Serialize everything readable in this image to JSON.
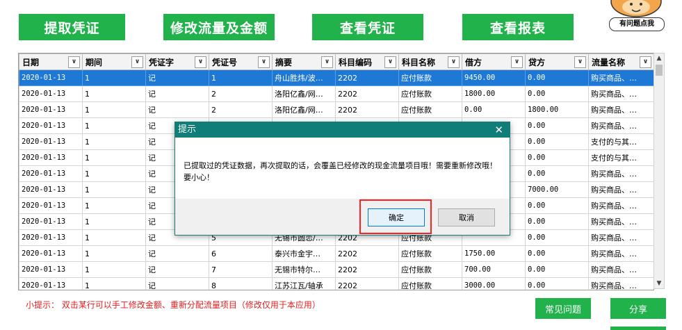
{
  "toolbar": {
    "extract_label": "提取凭证",
    "modify_label": "修改流量及金额",
    "view_voucher_label": "查看凭证",
    "view_report_label": "查看报表"
  },
  "help_mascot": {
    "label": "有问题点我",
    "icon": "monkey-mascot-icon"
  },
  "table": {
    "columns": [
      "日期",
      "期间",
      "凭证字",
      "凭证号",
      "摘要",
      "科目编码",
      "科目名称",
      "借方",
      "贷方",
      "流量名称"
    ],
    "rows": [
      [
        "2020-01-13",
        "1",
        "记",
        "1",
        "舟山胜炜/波…",
        "2202",
        "应付账款",
        "9450.00",
        "0.00",
        "购买商品、…"
      ],
      [
        "2020-01-13",
        "1",
        "记",
        "2",
        "洛阳亿鑫/网…",
        "2202",
        "应付账款",
        "1800.00",
        "0.00",
        "购买商品、…"
      ],
      [
        "2020-01-13",
        "1",
        "记",
        "2",
        "洛阳亿鑫/网…",
        "2202",
        "应付账款",
        "0.00",
        "1800.00",
        "购买商品、…"
      ],
      [
        "2020-01-13",
        "1",
        "记",
        "",
        "",
        "",
        "",
        "",
        "0.00",
        "购买商品、…"
      ],
      [
        "2020-01-13",
        "1",
        "记",
        "",
        "",
        "",
        "",
        "",
        "0.00",
        "支付的与其…"
      ],
      [
        "2020-01-13",
        "1",
        "记",
        "",
        "",
        "",
        "",
        "",
        "0.00",
        "支付的与其…"
      ],
      [
        "2020-01-13",
        "1",
        "记",
        "",
        "",
        "",
        "",
        "",
        "0.00",
        "购买商品、…"
      ],
      [
        "2020-01-13",
        "1",
        "记",
        "",
        "",
        "",
        "",
        "",
        "7000.00",
        "购买商品、…"
      ],
      [
        "2020-01-13",
        "1",
        "记",
        "",
        "",
        "",
        "",
        "",
        "0.00",
        "购买商品、…"
      ],
      [
        "2020-01-13",
        "1",
        "记",
        "",
        "",
        "",
        "",
        "",
        "0.00",
        "购买商品、…"
      ],
      [
        "2020-01-13",
        "1",
        "记",
        "5",
        "无锡市圆恋/…",
        "2202",
        "应付账款",
        "",
        "0.00",
        "购买商品、…"
      ],
      [
        "2020-01-13",
        "1",
        "记",
        "6",
        "泰兴市金宇…",
        "2202",
        "应付账款",
        "1750.00",
        "0.00",
        "购买商品、…"
      ],
      [
        "2020-01-13",
        "1",
        "记",
        "7",
        "无锡市特尔…",
        "2202",
        "应付账款",
        "700.00",
        "0.00",
        "购买商品、…"
      ],
      [
        "2020-01-13",
        "1",
        "记",
        "8",
        "江苏江瓦/轴承",
        "2202",
        "应付账款",
        "3000.00",
        "0.00",
        "购买商品、…"
      ]
    ],
    "selected_row": 0
  },
  "tip": "小提示：   双击某行可以手工修改金额、重新分配流量项目（修改仅用于本应用）",
  "bottom": {
    "faq_label": "常见问题",
    "share_label": "分享"
  },
  "dialog": {
    "title": "提示",
    "message": "已提取过的凭证数据，再次提取的话，会覆盖已经修改的现金流量项目哦！需要重新修改哦！要小心！",
    "ok_label": "确定",
    "cancel_label": "取消"
  },
  "colors": {
    "accent_green": "#21b24b",
    "selection_blue": "#1e78d6",
    "dialog_teal": "#0f7d78",
    "highlight_red": "#ff2020"
  }
}
